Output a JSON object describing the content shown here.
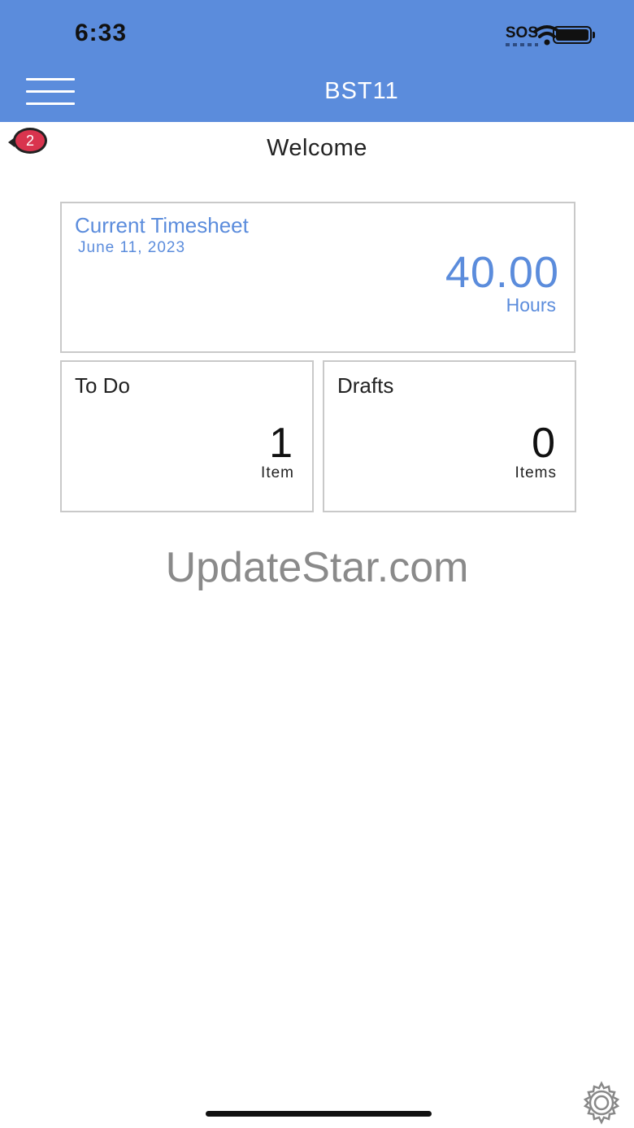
{
  "status_bar": {
    "time": "6:33",
    "sos": "SOS"
  },
  "nav": {
    "title": "BST11"
  },
  "notifications": {
    "count": "2"
  },
  "welcome": "Welcome",
  "timesheet": {
    "title": "Current Timesheet",
    "date": "June 11, 2023",
    "hours": "40.00",
    "hours_label": "Hours"
  },
  "todo": {
    "title": "To Do",
    "count": "1",
    "unit": "Item"
  },
  "drafts": {
    "title": "Drafts",
    "count": "0",
    "unit": "Items"
  },
  "watermark": "UpdateStar.com",
  "icons": {
    "menu": "hamburger-icon",
    "settings": "gear-icon",
    "wifi": "wifi-icon",
    "battery": "battery-icon"
  },
  "colors": {
    "accent": "#5b8cdc",
    "badge": "#d9344e"
  }
}
